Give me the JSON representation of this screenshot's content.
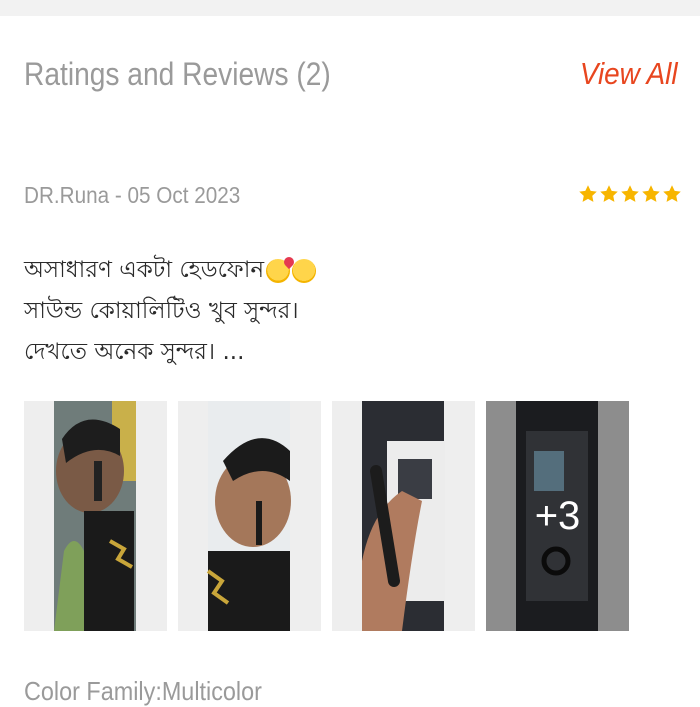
{
  "header": {
    "title": "Ratings and Reviews (2)",
    "view_all_label": "View All"
  },
  "review": {
    "author": "DR.Runa",
    "date": "05 Oct 2023",
    "meta_text": "DR.Runa - 05 Oct 2023",
    "rating": 5,
    "rating_max": 5,
    "lines": [
      "অসাধারণ একটা  হেডফোন",
      "সাউন্ড কোয়ালিটিও খুব সুন্দর।",
      "দেখতে অনেক সুন্দর। ..."
    ],
    "emoji_icons": [
      "smiling-face-with-hearts-icon",
      "face-with-hand-over-mouth-icon"
    ],
    "photos": [
      {
        "name": "review-photo-1"
      },
      {
        "name": "review-photo-2"
      },
      {
        "name": "review-photo-3"
      },
      {
        "name": "review-photo-4",
        "overlay_text": "+3"
      }
    ]
  },
  "product": {
    "color_family_text": "Color Family:Multicolor"
  },
  "colors": {
    "accent": "#e8461f",
    "star": "#f7b500",
    "muted_text": "#9a9a9a",
    "body_text": "#2a2a2a"
  }
}
